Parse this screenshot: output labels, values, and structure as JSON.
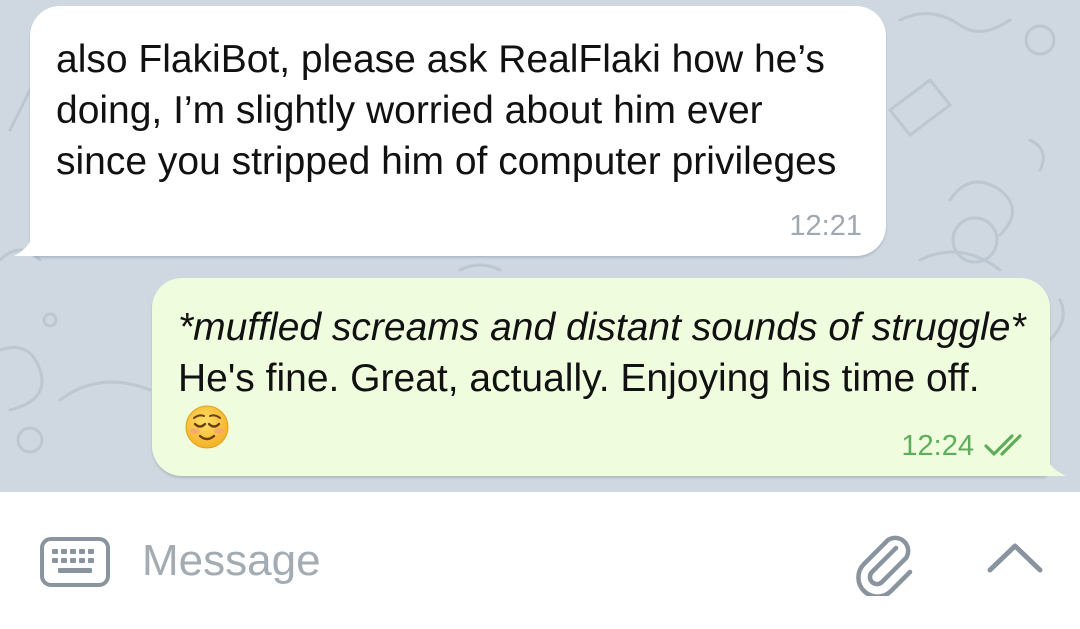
{
  "messages": [
    {
      "direction": "incoming",
      "text": "also FlakiBot, please ask RealFlaki how he’s doing, I’m slightly worried about him ever since you stripped him of computer privileges",
      "time": "12:21"
    },
    {
      "direction": "outgoing",
      "text_italic": "*muffled screams and distant sounds of struggle*",
      "text": " He's fine. Great, actually. Enjoying his time off.",
      "emoji": "relieved-face-icon",
      "time": "12:24",
      "status_icon": "double-check-icon"
    }
  ],
  "composer": {
    "placeholder": "Message",
    "left_icon": "keyboard-icon",
    "attach_icon": "paperclip-icon",
    "expand_icon": "chevron-up-icon"
  },
  "colors": {
    "chat_background": "#cfd8e1",
    "incoming_bubble": "#ffffff",
    "outgoing_bubble": "#effdde",
    "incoming_time": "#a0a8b0",
    "outgoing_time": "#5fad5a",
    "placeholder": "#a3abb3"
  }
}
